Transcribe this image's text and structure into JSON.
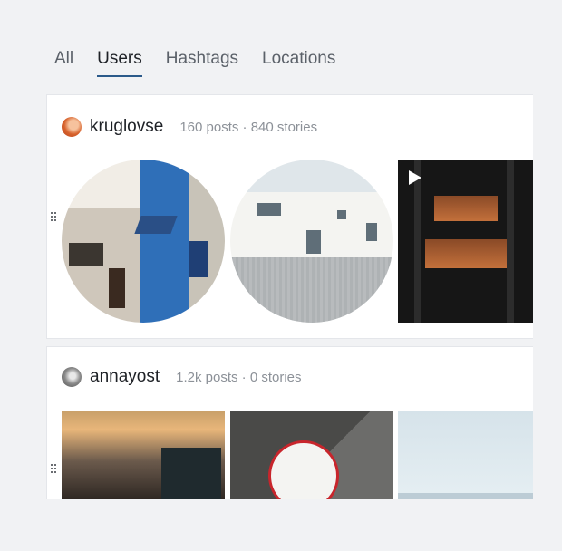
{
  "tabs": [
    {
      "label": "All",
      "active": false
    },
    {
      "label": "Users",
      "active": true
    },
    {
      "label": "Hashtags",
      "active": false
    },
    {
      "label": "Locations",
      "active": false
    }
  ],
  "results": [
    {
      "username": "kruglovse",
      "meta": "160 posts · 840 stories",
      "thumbnails": [
        {
          "kind": "story",
          "subject": "blue street facade"
        },
        {
          "kind": "story",
          "subject": "white house"
        },
        {
          "kind": "post-video",
          "subject": "dark glass building",
          "icon": "play-icon"
        }
      ]
    },
    {
      "username": "annayost",
      "meta": "1.2k posts · 0 stories",
      "thumbnails": [
        {
          "kind": "post",
          "subject": "city street at sunset"
        },
        {
          "kind": "post",
          "subject": "ajax stadium sign"
        },
        {
          "kind": "post",
          "subject": "pale sky over sea"
        }
      ]
    }
  ],
  "colors": {
    "active_tab_underline": "#2b5a8a",
    "meta_text": "#8c9198",
    "background": "#f1f2f4"
  }
}
